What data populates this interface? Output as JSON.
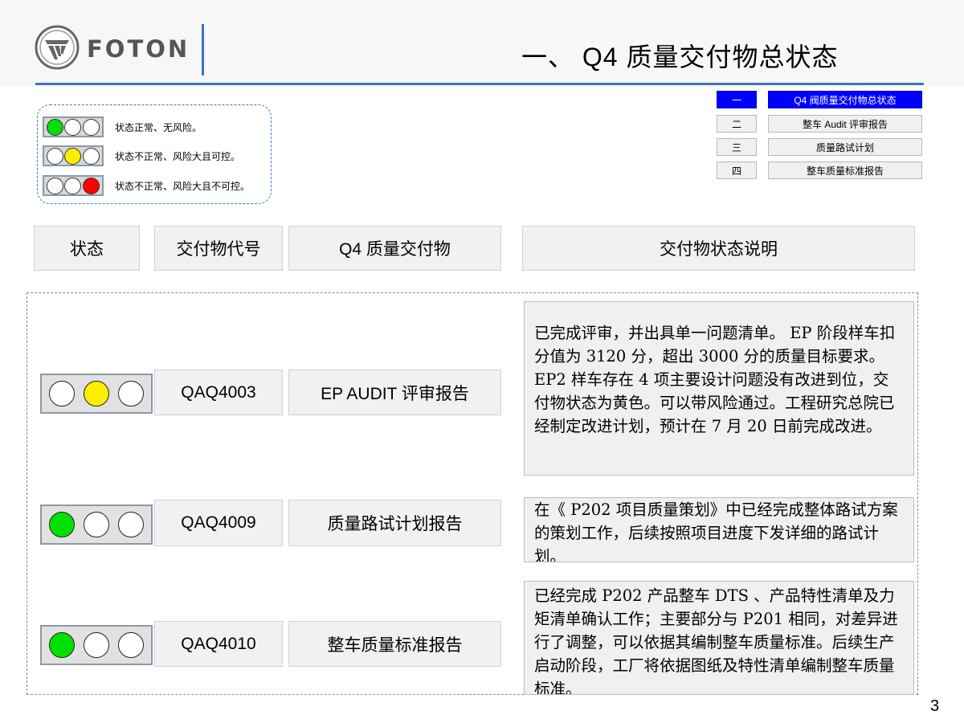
{
  "brand": {
    "name": "FOTON"
  },
  "page": {
    "title": "一、 Q4 质量交付物总状态",
    "number": "3"
  },
  "legend": [
    {
      "lights": [
        "green",
        "white",
        "white"
      ],
      "text": "状态正常、无风险。"
    },
    {
      "lights": [
        "white",
        "yellow",
        "white"
      ],
      "text": "状态不正常、风险大且可控。"
    },
    {
      "lights": [
        "white",
        "white",
        "red"
      ],
      "text": "状态不正常、风险大且不可控。"
    }
  ],
  "nav": [
    {
      "num": "一",
      "label": "Q4 阀质量交付物总状态",
      "active": true
    },
    {
      "num": "二",
      "label": "整车 Audit 评审报告",
      "active": false
    },
    {
      "num": "三",
      "label": "质量路试计划",
      "active": false
    },
    {
      "num": "四",
      "label": "整车质量标准报告",
      "active": false
    }
  ],
  "columns": {
    "status": "状态",
    "code": "交付物代号",
    "deliverable": "Q4 质量交付物",
    "description": "交付物状态说明"
  },
  "colors": {
    "green": "#00e000",
    "yellow": "#ffee00",
    "red": "#ff0000",
    "accent": "#3f73b8",
    "nav_active": "#0000ff"
  },
  "rows": [
    {
      "status": "yellow",
      "lights": [
        "white",
        "yellow",
        "white"
      ],
      "code": "QAQ4003",
      "deliverable": "EP AUDIT 评审报告",
      "description": "已完成评审，并出具单一问题清单。 EP 阶段样车扣分值为 3120 分，超出 3000 分的质量目标要求。 EP2 样车存在 4 项主要设计问题没有改进到位，交付物状态为黄色。可以带风险通过。工程研究总院已经制定改进计划，预计在 7 月 20 日前完成改进。"
    },
    {
      "status": "green",
      "lights": [
        "green",
        "white",
        "white"
      ],
      "code": "QAQ4009",
      "deliverable": "质量路试计划报告",
      "description": "在《 P202 项目质量策划》中已经完成整体路试方案的策划工作，后续按照项目进度下发详细的路试计划。"
    },
    {
      "status": "green",
      "lights": [
        "green",
        "white",
        "white"
      ],
      "code": "QAQ4010",
      "deliverable": "整车质量标准报告",
      "description": "已经完成 P202 产品整车 DTS 、产品特性清单及力矩清单确认工作；主要部分与 P201 相同，对差异进行了调整，可以依据其编制整车质量标准。后续生产启动阶段，工厂将依据图纸及特性清单编制整车质量标准。"
    }
  ]
}
